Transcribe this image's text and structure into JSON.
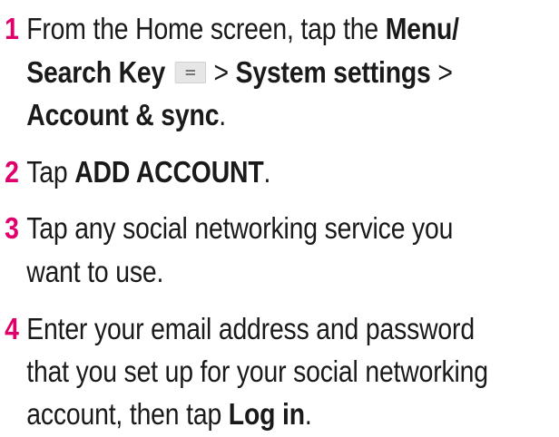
{
  "steps": [
    {
      "number": "1",
      "line1_a": "From the Home screen, tap the ",
      "line1_b": "Menu/",
      "line2_a": "Search Key",
      "menu_icon": "menu-key-icon",
      "line2_sep1": "> ",
      "line2_b": "System settings",
      "line2_sep2": " >",
      "line3_a": "Account & sync",
      "line3_end": "."
    },
    {
      "number": "2",
      "text_a": "Tap ",
      "text_b": "ADD ACCOUNT",
      "text_end": "."
    },
    {
      "number": "3",
      "line1": "Tap any social networking service you",
      "line2": "want to use."
    },
    {
      "number": "4",
      "line1": "Enter your email address and password",
      "line2": "that you set up for your social networking",
      "line3_a": "account, then tap ",
      "line3_b": "Log in",
      "line3_end": "."
    }
  ]
}
